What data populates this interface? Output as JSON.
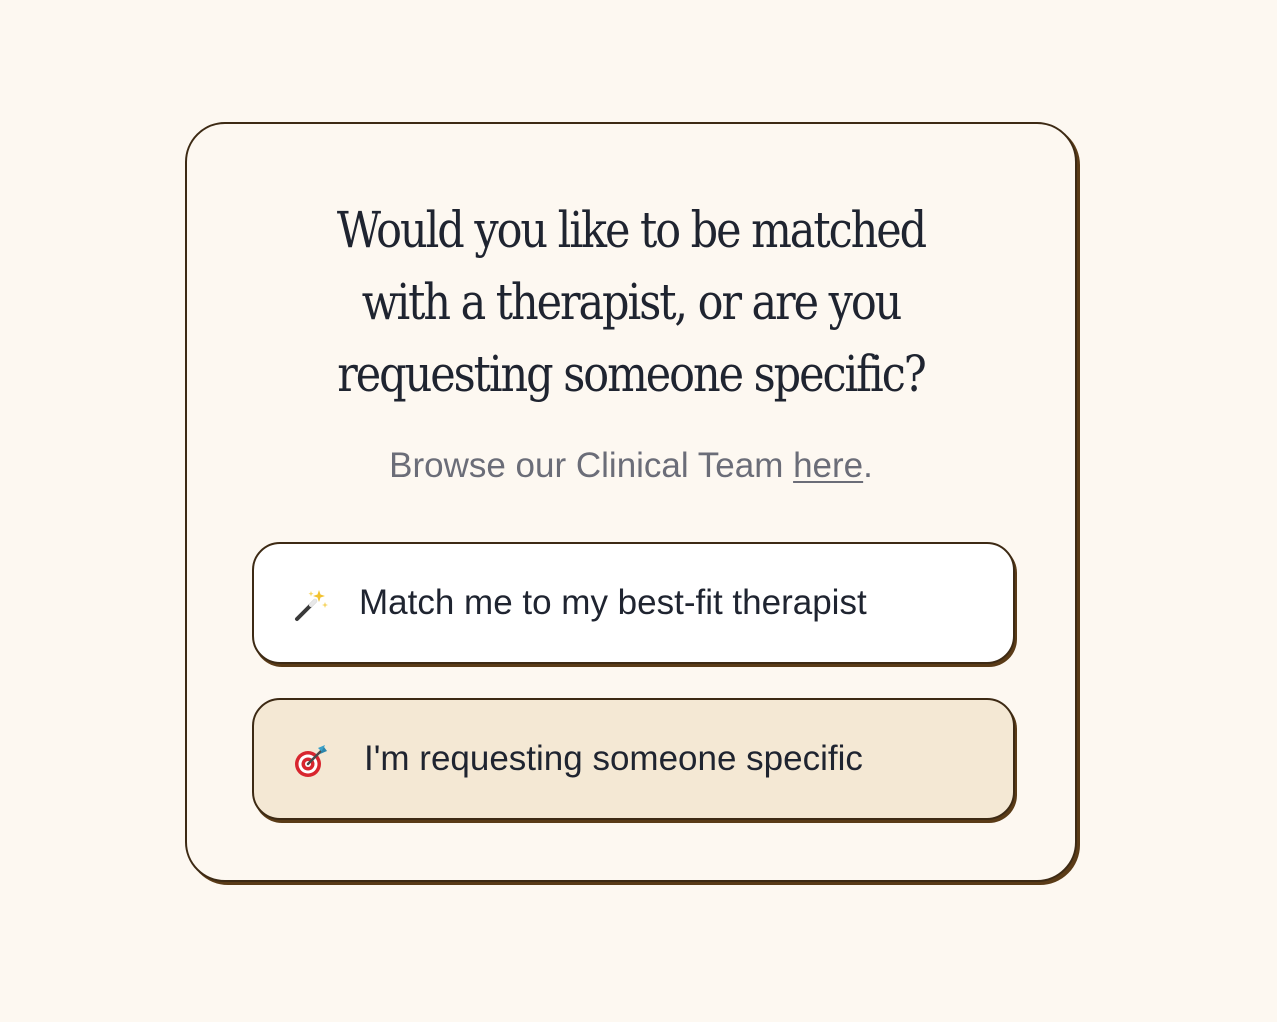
{
  "question": {
    "title": "Would you like to be matched with a therapist, or are you requesting someone specific?",
    "browse_prefix": "Browse our Clinical Team ",
    "browse_link": "here",
    "browse_suffix": "."
  },
  "options": [
    {
      "label": "Match me to my best-fit therapist",
      "icon": "magic-wand-icon"
    },
    {
      "label": "I'm requesting someone specific",
      "icon": "target-dart-icon"
    }
  ],
  "colors": {
    "background": "#fdf8f1",
    "border": "#3d2a14",
    "text": "#1f2430",
    "muted_text": "#6b6d78",
    "option_highlight": "#f4e8d4"
  }
}
